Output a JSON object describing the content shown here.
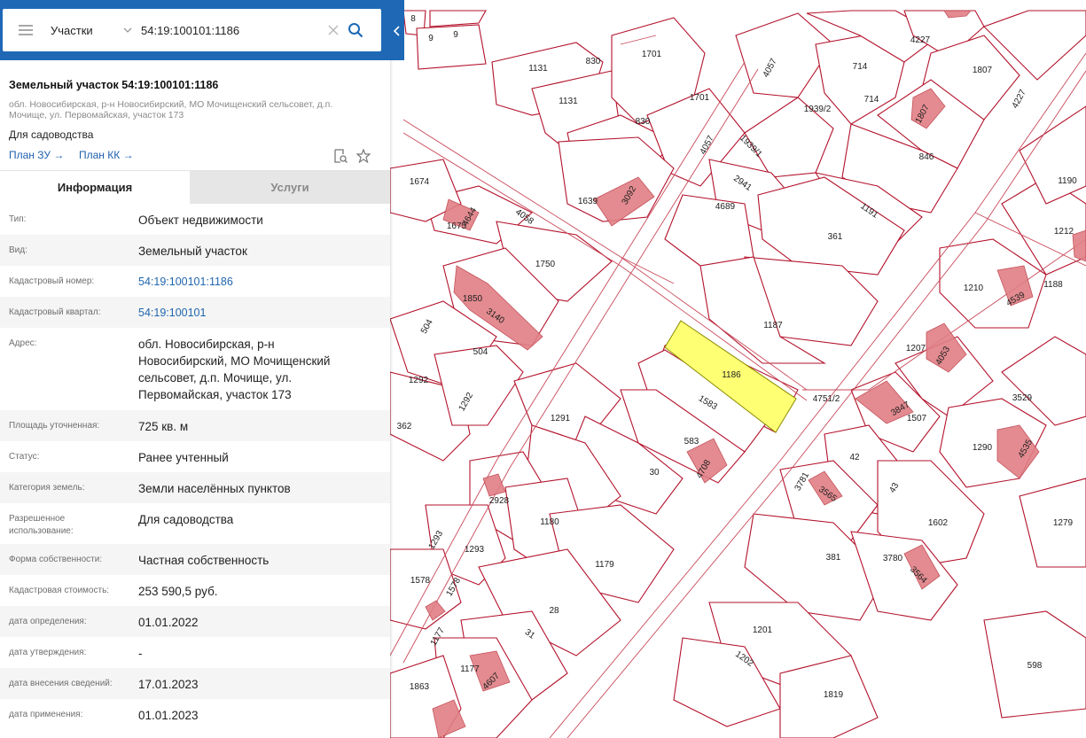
{
  "search": {
    "layer": "Участки",
    "query": "54:19:100101:1186"
  },
  "card": {
    "title": "Земельный участок 54:19:100101:1186",
    "address_line": "обл. Новосибирская, р-н Новосибирский, МО Мочищенский сельсовет, д.п. Мочище, ул. Первомайская, участок 173",
    "use": "Для садоводства",
    "link_plan_zu": "План ЗУ →",
    "link_plan_kk": "План КК →"
  },
  "tabs": {
    "info": "Информация",
    "services": "Услуги"
  },
  "rows": [
    {
      "key": "Тип:",
      "value": "Объект недвижимости"
    },
    {
      "key": "Вид:",
      "value": "Земельный участок"
    },
    {
      "key": "Кадастровый номер:",
      "value": "54:19:100101:1186"
    },
    {
      "key": "Кадастровый квартал:",
      "value": "54:19:100101"
    },
    {
      "key": "Адрес:",
      "value": "обл. Новосибирская, р-н Новосибирский, МО Мочищенский сельсовет, д.п. Мочище, ул. Первомайская, участок 173"
    },
    {
      "key": "Площадь уточненная:",
      "value": "725 кв. м"
    },
    {
      "key": "Статус:",
      "value": "Ранее учтенный"
    },
    {
      "key": "Категория земель:",
      "value": "Земли населённых пунктов"
    },
    {
      "key": "Разрешенное использование:",
      "value": "Для садоводства"
    },
    {
      "key": "Форма собственности:",
      "value": "Частная собственность"
    },
    {
      "key": "Кадастровая стоимость:",
      "value": "253 590,5 руб."
    },
    {
      "key": "дата определения:",
      "value": "01.01.2022"
    },
    {
      "key": "дата утверждения:",
      "value": "-"
    },
    {
      "key": "дата внесения сведений:",
      "value": "17.01.2023"
    },
    {
      "key": "дата применения:",
      "value": "01.01.2023"
    }
  ],
  "map": {
    "selected_label": "1186",
    "selected_color": "#ffff73",
    "labels": [
      "8",
      "9",
      "9",
      "1131",
      "830",
      "1701",
      "4057",
      "4227",
      "714",
      "1807",
      "1131",
      "1701",
      "830",
      "714",
      "1939/2",
      "4227",
      "1807",
      "4057",
      "1939/1",
      "846",
      "1674",
      "2941",
      "1190",
      "4058",
      "4689",
      "1191",
      "1639",
      "3092",
      "1675",
      "4644",
      "361",
      "1212",
      "1750",
      "1188",
      "1210",
      "1850",
      "3140",
      "4539",
      "504",
      "1187",
      "504",
      "1292",
      "1292",
      "1207",
      "4053",
      "1186",
      "1583",
      "4751/2",
      "3529",
      "362",
      "3847",
      "1291",
      "1507",
      "583",
      "4708",
      "1290",
      "4535",
      "42",
      "30",
      "3781",
      "3565",
      "43",
      "2928",
      "1180",
      "1602",
      "1279",
      "1293",
      "1293",
      "1179",
      "381",
      "3780",
      "3564",
      "1578",
      "1578",
      "28",
      "1201",
      "1177",
      "31",
      "1202",
      "598",
      "1863",
      "1177",
      "4607",
      "1819"
    ]
  }
}
